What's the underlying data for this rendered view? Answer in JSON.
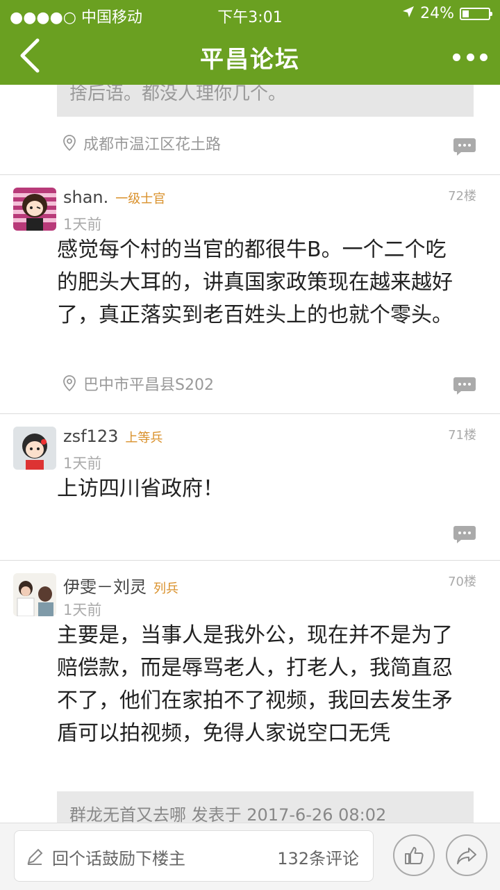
{
  "status_bar": {
    "carrier": "●●●●○ 中国移动",
    "time": "下午3:01",
    "battery": "24%",
    "battery_level": 0.24
  },
  "header": {
    "title": "平昌论坛"
  },
  "top_fragment": {
    "quote_text": "捨后语。都没人理你几个。",
    "location": "成都市温江区花土路"
  },
  "posts": [
    {
      "username": "shan.",
      "rank": "一级士官",
      "time": "1天前",
      "floor": "72楼",
      "text": "感觉每个村的当官的都很牛B。一个二个吃的肥头大耳的，讲真国家政策现在越来越好了，真正落实到老百姓头上的也就个零头。",
      "location": "巴中市平昌县S202"
    },
    {
      "username": "zsf123",
      "rank": "上等兵",
      "time": "1天前",
      "floor": "71楼",
      "text": "上访四川省政府！"
    },
    {
      "username": "伊雯－刘灵",
      "rank": "列兵",
      "time": "1天前",
      "floor": "70楼",
      "text": "主要是，当事人是我外公，现在并不是为了赔偿款，而是辱骂老人，打老人，我简直忍不了，他们在家拍不了视频，我回去发生矛盾可以拍视频，免得人家说空口无凭",
      "quote": "群龙无首又去哪 发表于 2017-6-26 08:02"
    }
  ],
  "footer": {
    "placeholder": "回个话鼓励下楼主",
    "comment_count": "132条评论"
  },
  "colors": {
    "accent": "#6aa021",
    "rank": "#d9902a"
  }
}
